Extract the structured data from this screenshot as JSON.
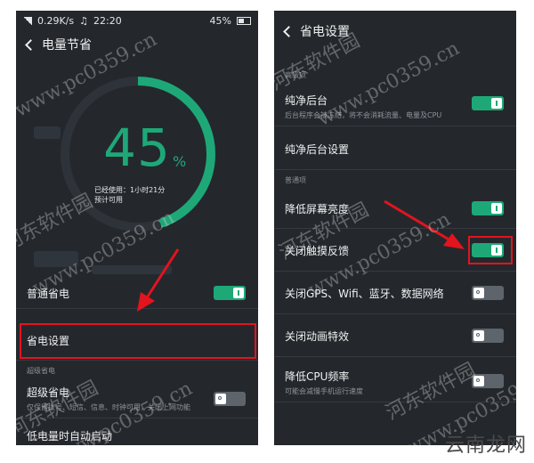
{
  "left_screen": {
    "status": {
      "speed": "0.29K/s",
      "time": "22:20",
      "battery": "45%"
    },
    "title": "电量节省",
    "gauge": {
      "percent": "45",
      "percent_sign": "%",
      "level": 0.45,
      "used_label": "已经使用：1小时21分",
      "available_label": "预计可用"
    },
    "rows": [
      {
        "title": "普通省电",
        "desc": "",
        "toggle": "on"
      },
      {
        "title": "省电设置",
        "desc": "",
        "toggle": null
      },
      {
        "title": "超级省电",
        "desc": "仅保留拨号、短信、信息、时钟可用，关闭上网功能",
        "toggle": "off"
      },
      {
        "title": "低电量时自动启动",
        "desc": "",
        "toggle": null
      }
    ],
    "section_super": "超级省电"
  },
  "right_screen": {
    "title": "省电设置",
    "section_advanced": "高级项",
    "section_normal": "普通项",
    "rows": [
      {
        "title": "纯净后台",
        "desc": "后台程序会被冻结，将不会消耗流量、电量及CPU",
        "toggle": "on"
      },
      {
        "title": "纯净后台设置",
        "desc": "",
        "toggle": null
      },
      {
        "title": "降低屏幕亮度",
        "desc": "",
        "toggle": "on"
      },
      {
        "title": "关闭触摸反馈",
        "desc": "",
        "toggle": "on"
      },
      {
        "title": "关闭GPS、Wifi、蓝牙、数据网络",
        "desc": "",
        "toggle": "off"
      },
      {
        "title": "关闭动画特效",
        "desc": "",
        "toggle": "off"
      },
      {
        "title": "降低CPU频率",
        "desc": "可能会减慢手机运行速度",
        "toggle": "off"
      }
    ]
  },
  "watermarks": {
    "cn": "河东软件园",
    "url": "www.pc0359.cn"
  },
  "logo": "云南龙网",
  "colors": {
    "accent": "#1ea878",
    "highlight": "#e2141d",
    "background": "#24282d"
  }
}
